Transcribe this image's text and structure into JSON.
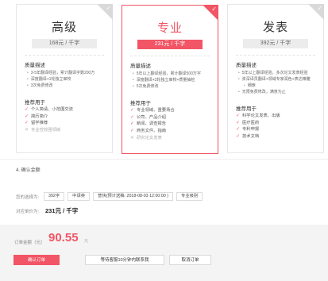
{
  "plans": [
    {
      "name": "高级",
      "price": "168元 / 千字",
      "quality_title": "质量描述",
      "quality": [
        "3-5年翻译经验，累计翻译字数200万",
        "深度翻译+1轮独立审校",
        "3次免费修改"
      ],
      "uses_title": "推荐用于",
      "uses": [
        {
          "text": "个人简请、小范围交流",
          "ok": true
        },
        {
          "text": "简历简介",
          "ok": true
        },
        {
          "text": "留学推荐",
          "ok": true
        },
        {
          "text": "专业性较强领域",
          "ok": false
        }
      ]
    },
    {
      "name": "专业",
      "price": "231元 / 千字",
      "quality_title": "质量描述",
      "quality": [
        "5年以上翻译经验，累计翻译500万字",
        "深度翻译+2轮独立审校+质量抽检",
        "5次免费修改"
      ],
      "uses_title": "推荐用于",
      "uses": [
        {
          "text": "专业领域、重要场合",
          "ok": true
        },
        {
          "text": "公司、产品介绍",
          "ok": true
        },
        {
          "text": "新闻、调查报告",
          "ok": true
        },
        {
          "text": "商务文件、指南",
          "ok": true
        },
        {
          "text": "研究论文发表",
          "ok": false
        }
      ]
    },
    {
      "name": "发表",
      "price": "392元 / 千字",
      "quality_title": "质量描述",
      "quality": [
        "5年以上翻译经验，多次论文发表经验",
        "资深译员翻译+领域专家润色+表达精雕",
        "细琢",
        "无限免费修改，满意为止"
      ],
      "uses_title": "推荐用于",
      "uses": [
        {
          "text": "科学论文发表、出版",
          "ok": true
        },
        {
          "text": "医疗医药",
          "ok": true
        },
        {
          "text": "专利申报",
          "ok": true
        },
        {
          "text": "技术文档",
          "ok": true
        }
      ]
    }
  ],
  "confirm": {
    "step_title": "4. 确认金额",
    "selected_label": "您的选择为:",
    "selected_tags": [
      "392字",
      "中译英",
      "普快(预计送稿: 2018-08-03 12:00:00 )",
      "专业级别"
    ],
    "unit_price_label": "对应单价为:",
    "unit_price": "231元 / 千字"
  },
  "summary": {
    "amount_label": "订单金额（元）",
    "amount": "90.55",
    "amount_unit": "元",
    "buttons": [
      "确认订单",
      "等待客服10分钟内联系我",
      "取消订单"
    ]
  },
  "colors": {
    "accent": "#f25565",
    "panel": "#f4f4f4"
  }
}
